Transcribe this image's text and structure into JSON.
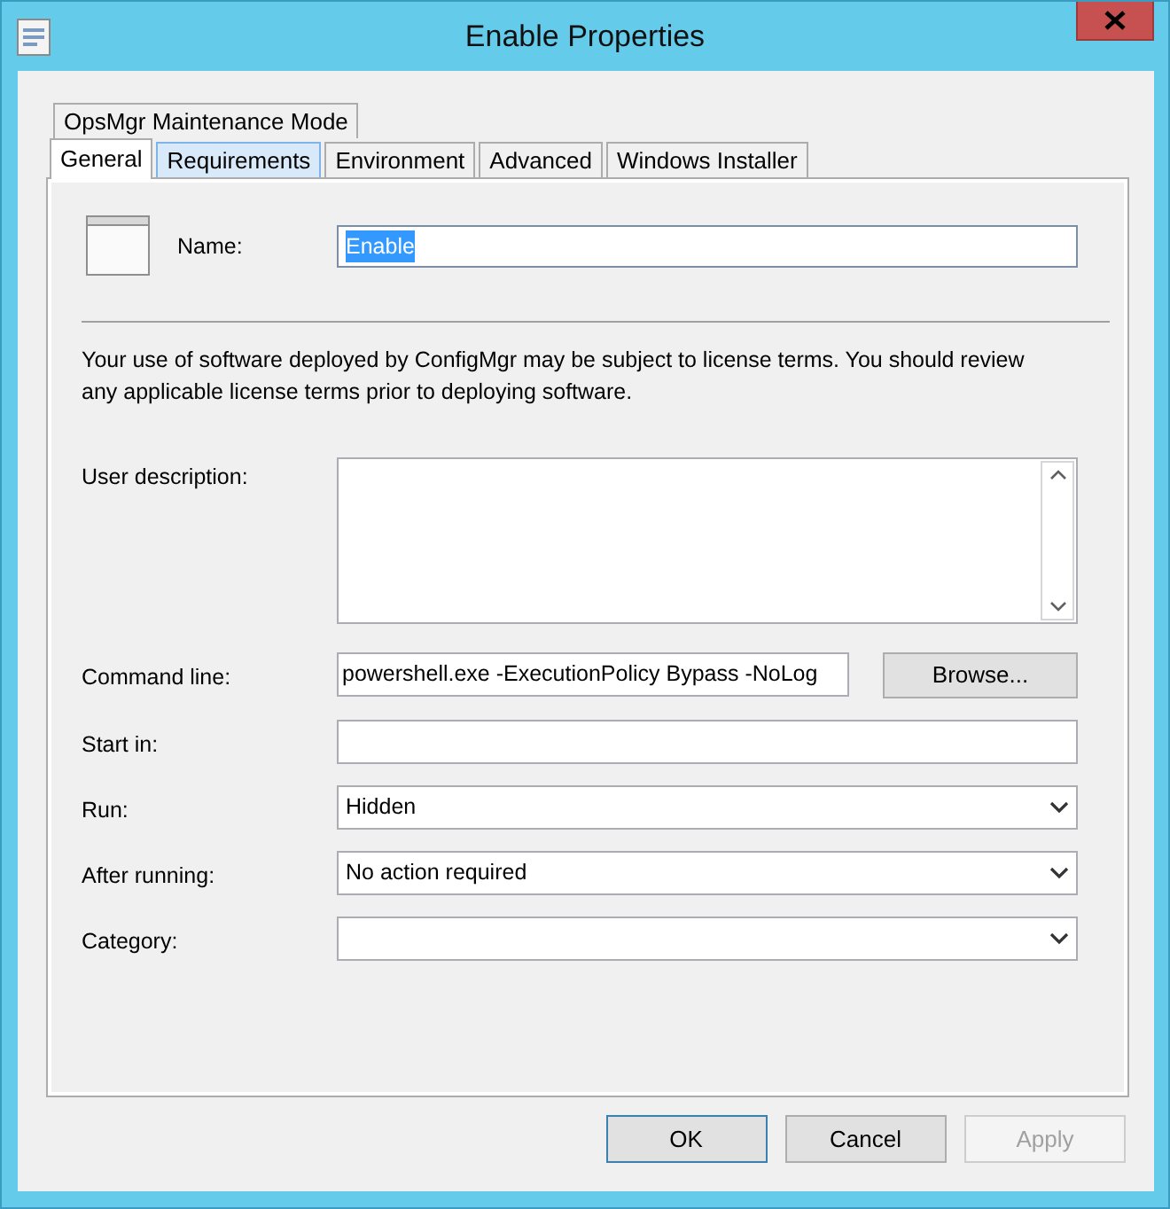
{
  "window": {
    "title": "Enable Properties"
  },
  "tab_rows": [
    [
      {
        "label": "OpsMgr Maintenance Mode",
        "selected": false,
        "hovered": false
      }
    ],
    [
      {
        "label": "General",
        "selected": true,
        "hovered": false
      },
      {
        "label": "Requirements",
        "selected": false,
        "hovered": true
      },
      {
        "label": "Environment",
        "selected": false,
        "hovered": false
      },
      {
        "label": "Advanced",
        "selected": false,
        "hovered": false
      },
      {
        "label": "Windows Installer",
        "selected": false,
        "hovered": false
      }
    ]
  ],
  "name": {
    "label": "Name:",
    "value": "Enable",
    "value_selected": true
  },
  "notice": "Your use of software deployed by ConfigMgr may be subject to license terms. You should review any applicable license terms prior to deploying software.",
  "fields": [
    {
      "kind": "textarea",
      "label": "User description:"
    },
    {
      "kind": "text",
      "label": "Command line:",
      "value": "powershell.exe -ExecutionPolicy Bypass -NoLog",
      "button": "Browse..."
    },
    {
      "kind": "text",
      "label": "Start in:"
    },
    {
      "kind": "dropdown",
      "label": "Run:",
      "value": "Hidden"
    },
    {
      "kind": "dropdown",
      "label": "After running:",
      "value": "No action required"
    },
    {
      "kind": "dropdown",
      "label": "Category:"
    }
  ],
  "buttons": [
    {
      "label": "OK",
      "default": true,
      "disabled": false
    },
    {
      "label": "Cancel",
      "default": false,
      "disabled": false
    },
    {
      "label": "Apply",
      "default": false,
      "disabled": true
    }
  ]
}
